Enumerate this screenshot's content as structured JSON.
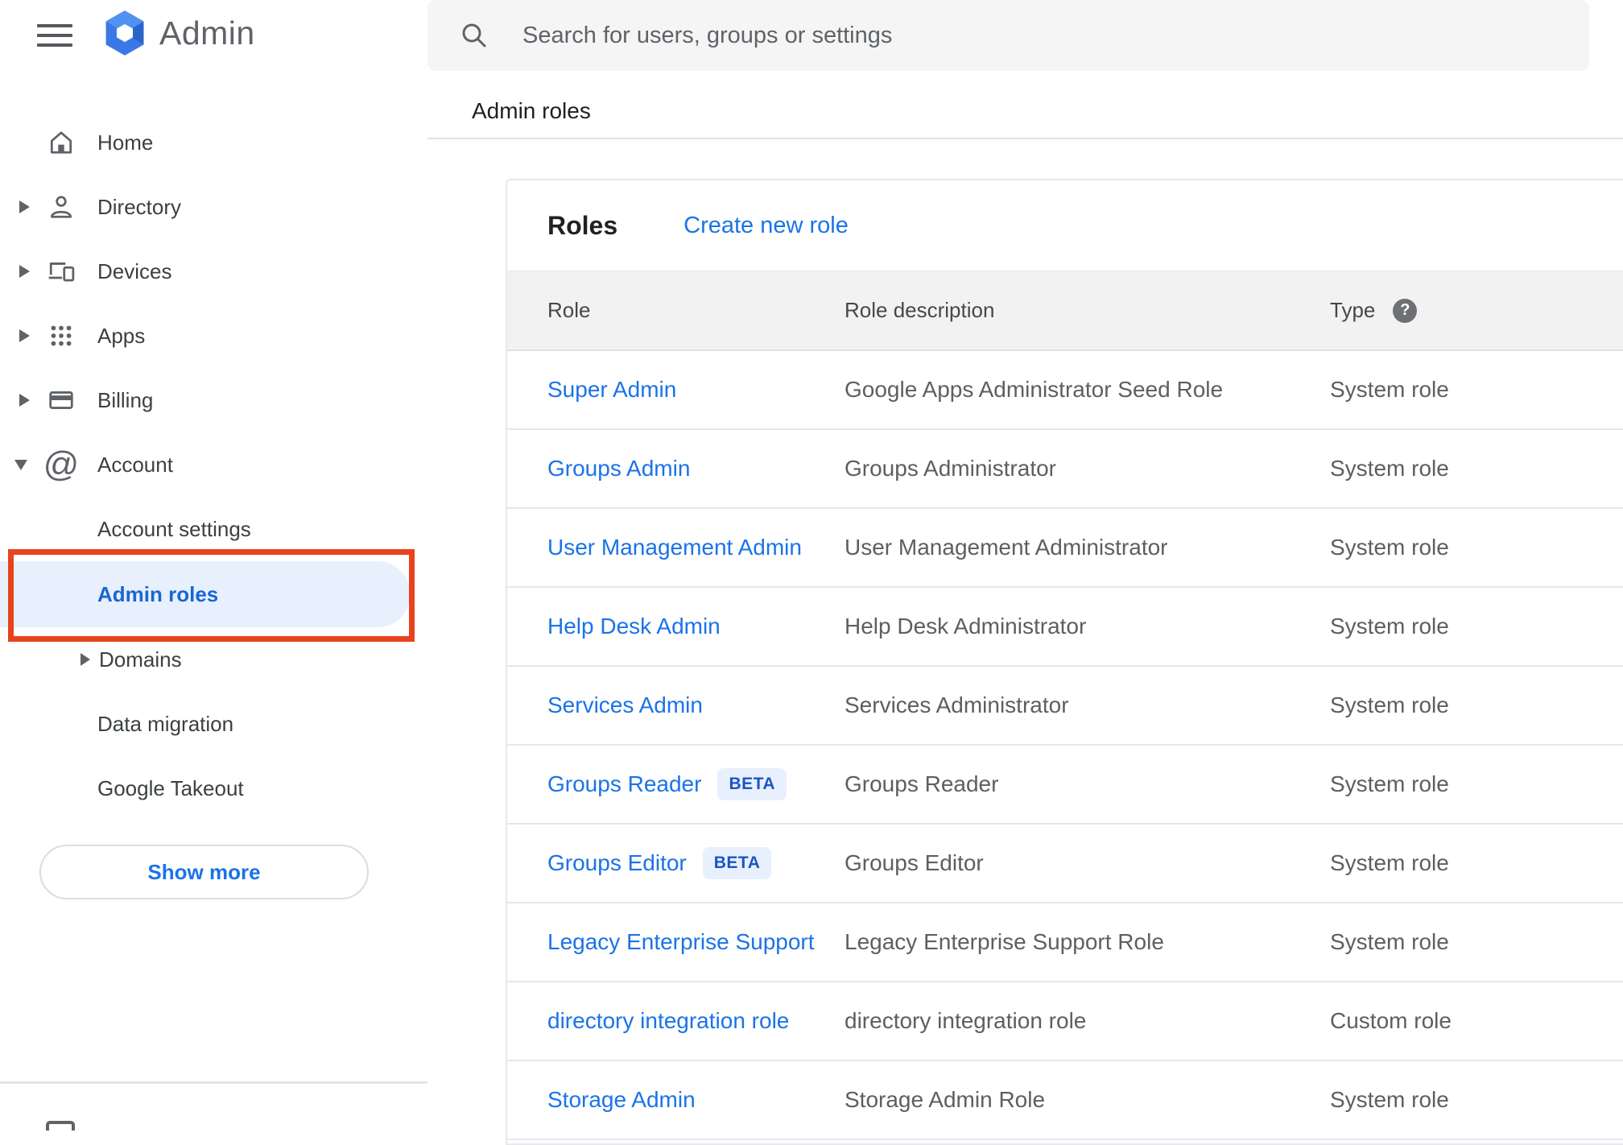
{
  "header": {
    "app_title": "Admin",
    "search_placeholder": "Search for users, groups or settings"
  },
  "breadcrumb": "Admin roles",
  "sidebar": {
    "items": [
      {
        "label": "Home",
        "icon": "home-icon",
        "expandable": false
      },
      {
        "label": "Directory",
        "icon": "person-icon",
        "expandable": true
      },
      {
        "label": "Devices",
        "icon": "devices-icon",
        "expandable": true
      },
      {
        "label": "Apps",
        "icon": "apps-grid-icon",
        "expandable": true
      },
      {
        "label": "Billing",
        "icon": "credit-card-icon",
        "expandable": true
      },
      {
        "label": "Account",
        "icon": "at-sign-icon",
        "expandable": true,
        "expanded": true
      },
      {
        "label": "Account settings"
      },
      {
        "label": "Admin roles",
        "selected": true,
        "annotated": true
      },
      {
        "label": "Domains",
        "expandable": true
      },
      {
        "label": "Data migration"
      },
      {
        "label": "Google Takeout"
      }
    ],
    "show_more_label": "Show more"
  },
  "main": {
    "card_title": "Roles",
    "create_link": "Create new role",
    "table": {
      "columns": [
        "Role",
        "Role description",
        "Type"
      ],
      "beta_badge_label": "BETA",
      "help_icon_glyph": "?",
      "rows": [
        {
          "role": "Super Admin",
          "beta": false,
          "description": "Google Apps Administrator Seed Role",
          "type": "System role"
        },
        {
          "role": "Groups Admin",
          "beta": false,
          "description": "Groups Administrator",
          "type": "System role"
        },
        {
          "role": "User Management Admin",
          "beta": false,
          "description": "User Management Administrator",
          "type": "System role"
        },
        {
          "role": "Help Desk Admin",
          "beta": false,
          "description": "Help Desk Administrator",
          "type": "System role"
        },
        {
          "role": "Services Admin",
          "beta": false,
          "description": "Services Administrator",
          "type": "System role"
        },
        {
          "role": "Groups Reader",
          "beta": true,
          "description": "Groups Reader",
          "type": "System role"
        },
        {
          "role": "Groups Editor",
          "beta": true,
          "description": "Groups Editor",
          "type": "System role"
        },
        {
          "role": "Legacy Enterprise Support",
          "beta": false,
          "description": "Legacy Enterprise Support Role",
          "type": "System role"
        },
        {
          "role": "directory integration role",
          "beta": false,
          "description": "directory integration role",
          "type": "Custom role"
        },
        {
          "role": "Storage Admin",
          "beta": false,
          "description": "Storage Admin Role",
          "type": "System role"
        }
      ]
    }
  },
  "colors": {
    "link_blue": "#1a73e8",
    "selected_blue": "#1967d2",
    "selected_pill_bg": "#e8f0fe",
    "annotation_red": "#e8431c",
    "icon_gray": "#5f6368",
    "table_header_bg": "#f2f2f2",
    "search_bg": "#f5f5f5"
  }
}
